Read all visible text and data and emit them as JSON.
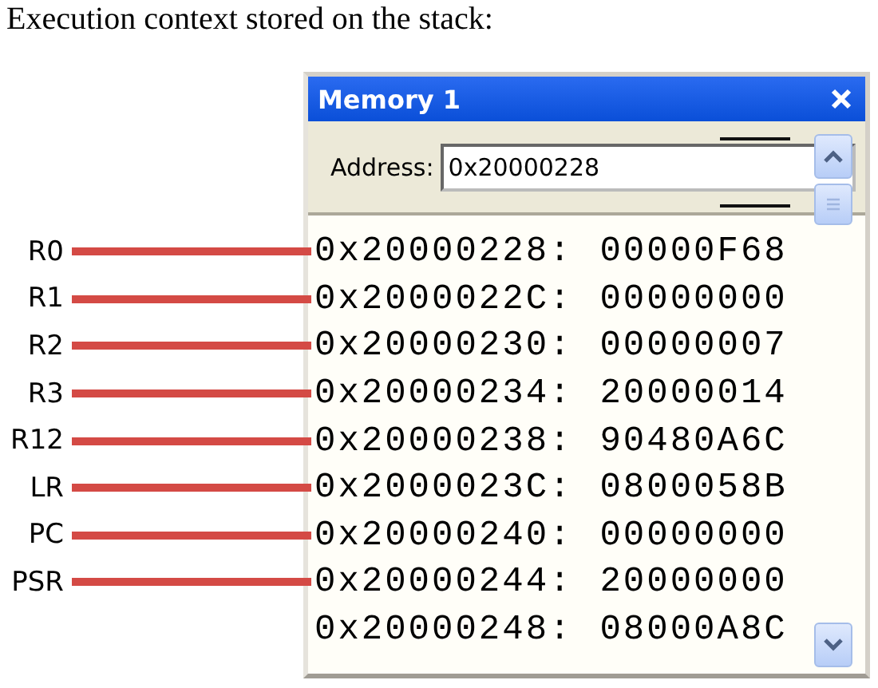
{
  "heading": "Execution context stored on the stack:",
  "window": {
    "title": "Memory 1"
  },
  "address": {
    "label": "Address:",
    "value": "0x20000228"
  },
  "rows": [
    {
      "register": "R0",
      "address": "0x20000228:",
      "value": "00000F68"
    },
    {
      "register": "R1",
      "address": "0x2000022C:",
      "value": "00000000"
    },
    {
      "register": "R2",
      "address": "0x20000230:",
      "value": "00000007"
    },
    {
      "register": "R3",
      "address": "0x20000234:",
      "value": "20000014"
    },
    {
      "register": "R12",
      "address": "0x20000238:",
      "value": "90480A6C"
    },
    {
      "register": "LR",
      "address": "0x2000023C:",
      "value": "0800058B"
    },
    {
      "register": "PC",
      "address": "0x20000240:",
      "value": "00000000"
    },
    {
      "register": "PSR",
      "address": "0x20000244:",
      "value": "20000000"
    },
    {
      "address": "0x20000248:",
      "value": "08000A8C"
    }
  ]
}
